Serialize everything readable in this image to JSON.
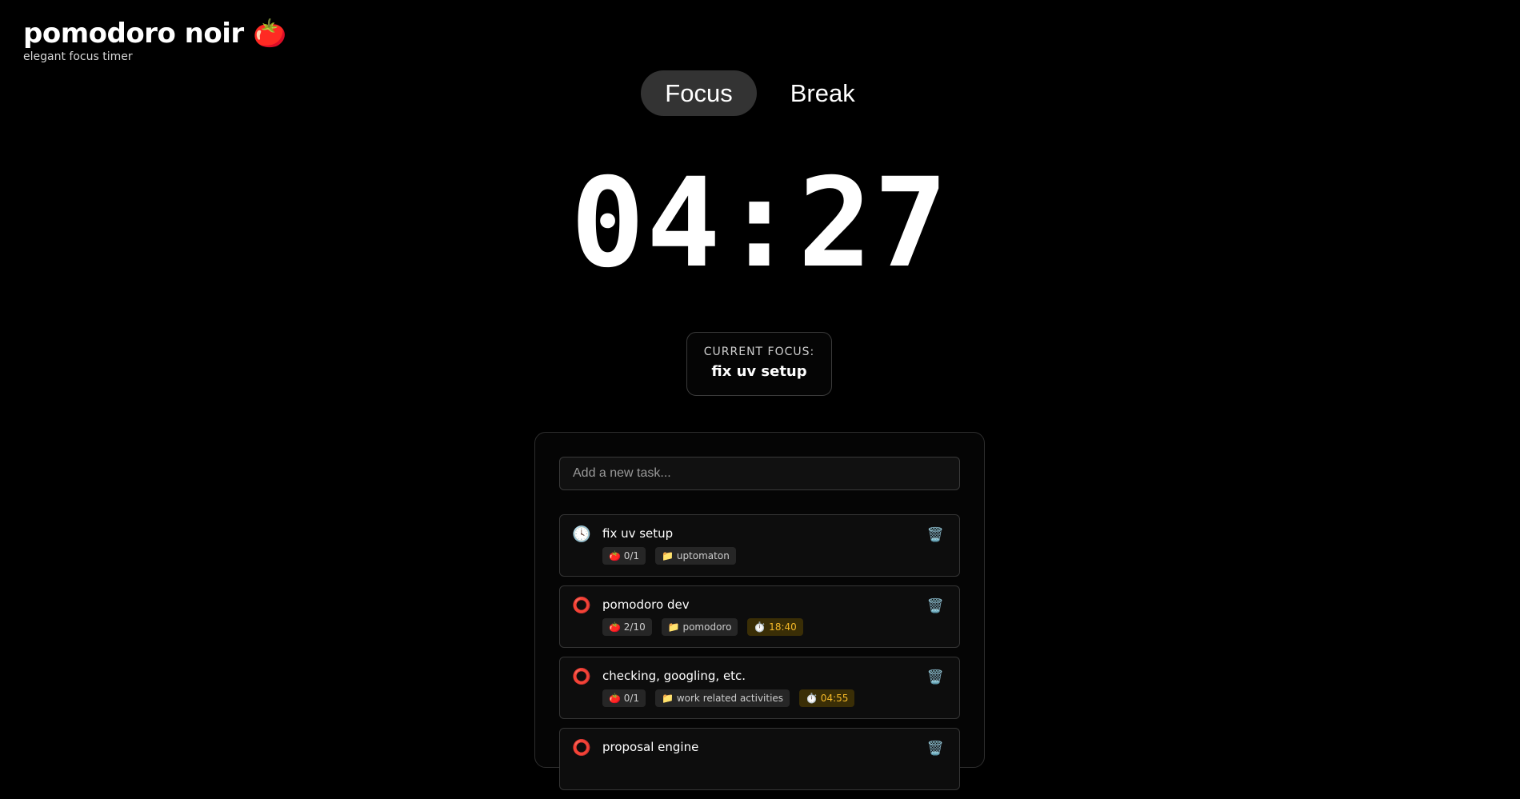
{
  "brand": {
    "title": "pomodoro noir 🍅",
    "subtitle": "elegant focus timer"
  },
  "modes": [
    {
      "label": "Focus",
      "active": true
    },
    {
      "label": "Break",
      "active": false
    }
  ],
  "timer": {
    "display": "04:27"
  },
  "current_focus": {
    "label": "CURRENT FOCUS:",
    "task": "fix uv setup"
  },
  "task_input": {
    "placeholder": "Add a new task...",
    "value": ""
  },
  "tasks": [
    {
      "status_icon": "🕓",
      "status": "in-progress",
      "name": "fix uv setup",
      "pomodoros": "🍅 0/1",
      "project": "📁 uptomaton",
      "time": ""
    },
    {
      "status_icon": "⭕",
      "status": "pending",
      "name": "pomodoro dev",
      "pomodoros": "🍅 2/10",
      "project": "📁 pomodoro",
      "time": "⏱️ 18:40"
    },
    {
      "status_icon": "⭕",
      "status": "pending",
      "name": "checking, googling, etc.",
      "pomodoros": "🍅 0/1",
      "project": "📁 work related activities",
      "time": "⏱️ 04:55"
    },
    {
      "status_icon": "⭕",
      "status": "pending",
      "name": "proposal engine",
      "pomodoros": "",
      "project": "",
      "time": ""
    }
  ],
  "delete_icon": "🗑️",
  "colors": {
    "background": "#000000",
    "active_tab": "#333333",
    "timer_tag_text": "#f5b928",
    "timer_tag_bg": "#3a2e06",
    "status_pending": "#e0442c"
  }
}
